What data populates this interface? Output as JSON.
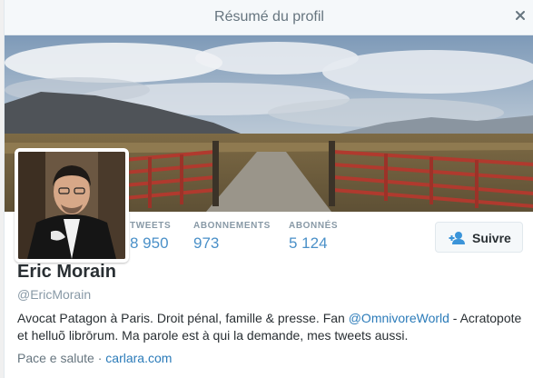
{
  "modal": {
    "title": "Résumé du profil",
    "close_icon": "close-icon"
  },
  "banner": {
    "description_icon": "landscape-photo"
  },
  "stats": [
    {
      "label": "TWEETS",
      "value": "8 950"
    },
    {
      "label": "ABONNEMENTS",
      "value": "973"
    },
    {
      "label": "ABONNÉS",
      "value": "5 124"
    }
  ],
  "follow_button": {
    "label": "Suivre",
    "icon": "add-user-icon"
  },
  "profile": {
    "name": "Eric Morain",
    "handle": "@EricMorain",
    "bio_part1": "Avocat Patagon à Paris. Droit pénal, famille & presse. Fan ",
    "bio_mention": "@OmnivoreWorld",
    "bio_part2": " - Acratopote et helluõ librōrum. Ma parole est à qui la demande, mes tweets aussi.",
    "location": "Pace e salute",
    "separator": " · ",
    "website": "carlara.com"
  },
  "colors": {
    "link": "#2b7bb9",
    "stat_value": "#4a90c8",
    "muted": "#8899a6",
    "text": "#292f33"
  }
}
